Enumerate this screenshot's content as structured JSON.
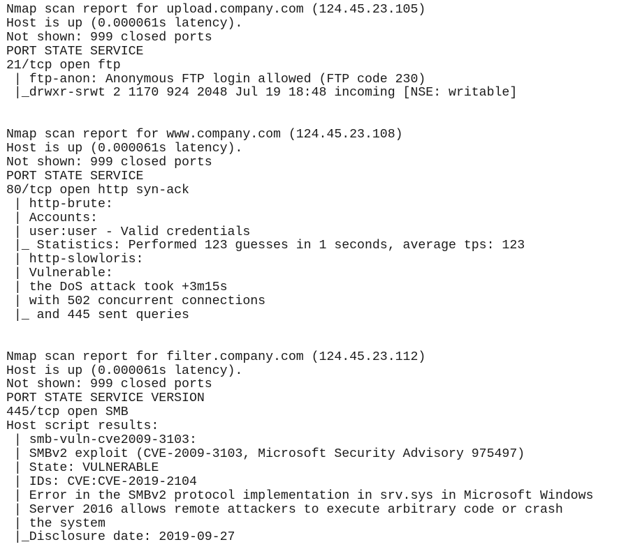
{
  "reports": [
    {
      "host": "upload.company.com",
      "lines": [
        "Nmap scan report for upload.company.com (124.45.23.105)",
        "Host is up (0.000061s latency).",
        "Not shown: 999 closed ports",
        "PORT STATE SERVICE",
        "21/tcp open ftp",
        " | ftp-anon: Anonymous FTP login allowed (FTP code 230)",
        " |_drwxr-srwt 2 1170 924 2048 Jul 19 18:48 incoming [NSE: writable]"
      ]
    },
    {
      "host": "www.company.com",
      "lines": [
        "Nmap scan report for www.company.com (124.45.23.108)",
        "Host is up (0.000061s latency).",
        "Not shown: 999 closed ports",
        "PORT STATE SERVICE",
        "80/tcp open http syn-ack",
        " | http-brute:",
        " | Accounts:",
        " | user:user - Valid credentials",
        " |_ Statistics: Performed 123 guesses in 1 seconds, average tps: 123",
        " | http-slowloris:",
        " | Vulnerable:",
        " | the DoS attack took +3m15s",
        " | with 502 concurrent connections",
        " |_ and 445 sent queries"
      ]
    },
    {
      "host": "filter.company.com",
      "lines": [
        "Nmap scan report for filter.company.com (124.45.23.112)",
        "Host is up (0.000061s latency).",
        "Not shown: 999 closed ports",
        "PORT STATE SERVICE VERSION",
        "445/tcp open SMB",
        "Host script results:",
        " | smb-vuln-cve2009-3103:",
        " | SMBv2 exploit (CVE-2009-3103, Microsoft Security Advisory 975497)",
        " | State: VULNERABLE",
        " | IDs: CVE:CVE-2019-2104",
        " | Error in the SMBv2 protocol implementation in srv.sys in Microsoft Windows",
        " | Server 2016 allows remote attackers to execute arbitrary code or crash",
        " | the system",
        " |_Disclosure date: 2019-09-27"
      ]
    }
  ]
}
